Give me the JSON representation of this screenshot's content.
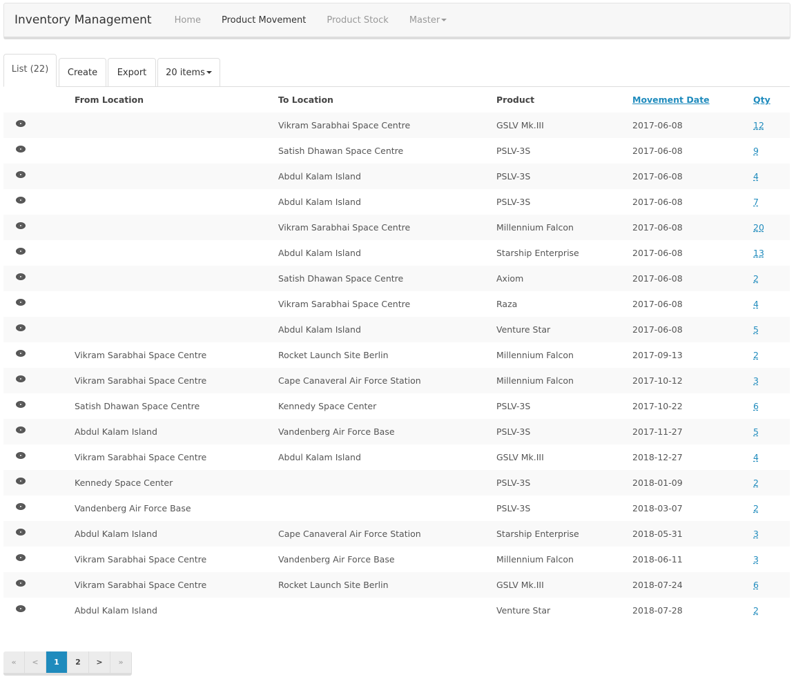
{
  "navbar": {
    "brand": "Inventory Management",
    "links": [
      "Home",
      "Product Movement",
      "Product Stock",
      "Master"
    ]
  },
  "tabs": {
    "list": "List (22)",
    "create": "Create",
    "export": "Export",
    "items": "20 items"
  },
  "table": {
    "headers": [
      "From Location",
      "To Location",
      "Product",
      "Movement Date",
      "Qty"
    ],
    "rows": [
      [
        "",
        "Vikram Sarabhai Space Centre",
        "GSLV Mk.III",
        "2017-06-08",
        "12"
      ],
      [
        "",
        "Satish Dhawan Space Centre",
        "PSLV-3S",
        "2017-06-08",
        "9"
      ],
      [
        "",
        "Abdul Kalam Island",
        "PSLV-3S",
        "2017-06-08",
        "4"
      ],
      [
        "",
        "Abdul Kalam Island",
        "PSLV-3S",
        "2017-06-08",
        "7"
      ],
      [
        "",
        "Vikram Sarabhai Space Centre",
        "Millennium Falcon",
        "2017-06-08",
        "20"
      ],
      [
        "",
        "Abdul Kalam Island",
        "Starship Enterprise",
        "2017-06-08",
        "13"
      ],
      [
        "",
        "Satish Dhawan Space Centre",
        "Axiom",
        "2017-06-08",
        "2"
      ],
      [
        "",
        "Vikram Sarabhai Space Centre",
        "Raza",
        "2017-06-08",
        "4"
      ],
      [
        "",
        "Abdul Kalam Island",
        "Venture Star",
        "2017-06-08",
        "5"
      ],
      [
        "Vikram Sarabhai Space Centre",
        "Rocket Launch Site Berlin",
        "Millennium Falcon",
        "2017-09-13",
        "2"
      ],
      [
        "Vikram Sarabhai Space Centre",
        "Cape Canaveral Air Force Station",
        "Millennium Falcon",
        "2017-10-12",
        "3"
      ],
      [
        "Satish Dhawan Space Centre",
        "Kennedy Space Center",
        "PSLV-3S",
        "2017-10-22",
        "6"
      ],
      [
        "Abdul Kalam Island",
        "Vandenberg Air Force Base",
        "PSLV-3S",
        "2017-11-27",
        "5"
      ],
      [
        "Vikram Sarabhai Space Centre",
        "Abdul Kalam Island",
        "GSLV Mk.III",
        "2018-12-27",
        "4"
      ],
      [
        "Kennedy Space Center",
        "",
        "PSLV-3S",
        "2018-01-09",
        "2"
      ],
      [
        "Vandenberg Air Force Base",
        "",
        "PSLV-3S",
        "2018-03-07",
        "2"
      ],
      [
        "Abdul Kalam Island",
        "Cape Canaveral Air Force Station",
        "Starship Enterprise",
        "2018-05-31",
        "3"
      ],
      [
        "Vikram Sarabhai Space Centre",
        "Vandenberg Air Force Base",
        "Millennium Falcon",
        "2018-06-11",
        "3"
      ],
      [
        "Vikram Sarabhai Space Centre",
        "Rocket Launch Site Berlin",
        "GSLV Mk.III",
        "2018-07-24",
        "6"
      ],
      [
        "Abdul Kalam Island",
        "",
        "Venture Star",
        "2018-07-28",
        "2"
      ]
    ]
  },
  "pagination": {
    "first": "«",
    "prev": "<",
    "pages": [
      "1",
      "2"
    ],
    "current": "1",
    "next": ">",
    "last": "»"
  },
  "colors": {
    "accent": "#1f8bbd"
  }
}
